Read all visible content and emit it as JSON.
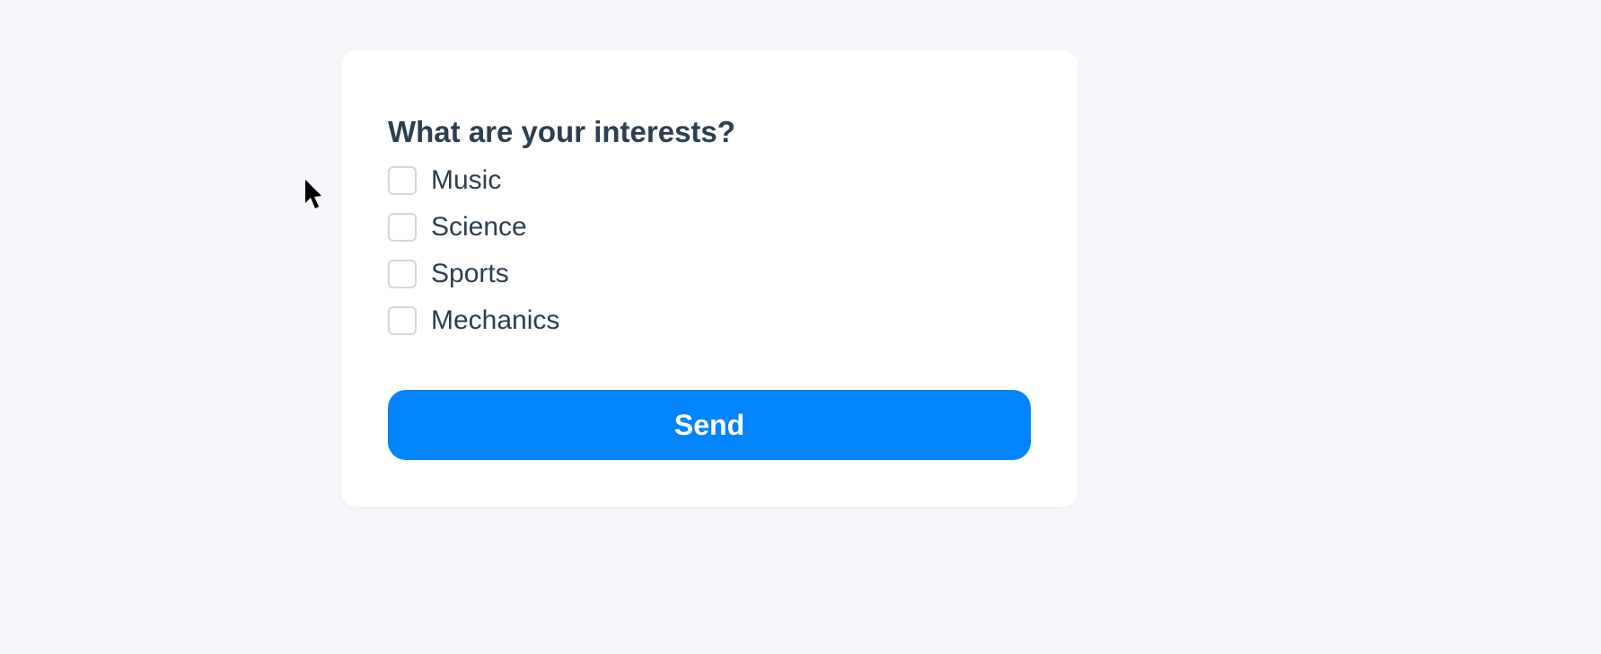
{
  "form": {
    "title": "What are your interests?",
    "options": [
      {
        "label": "Music"
      },
      {
        "label": "Science"
      },
      {
        "label": "Sports"
      },
      {
        "label": "Mechanics"
      }
    ],
    "submit_label": "Send"
  },
  "colors": {
    "primary": "#0084ff",
    "text": "#2c3e50",
    "background": "#f5f7fa",
    "card": "#ffffff",
    "checkbox_border": "#d6d6d6"
  }
}
